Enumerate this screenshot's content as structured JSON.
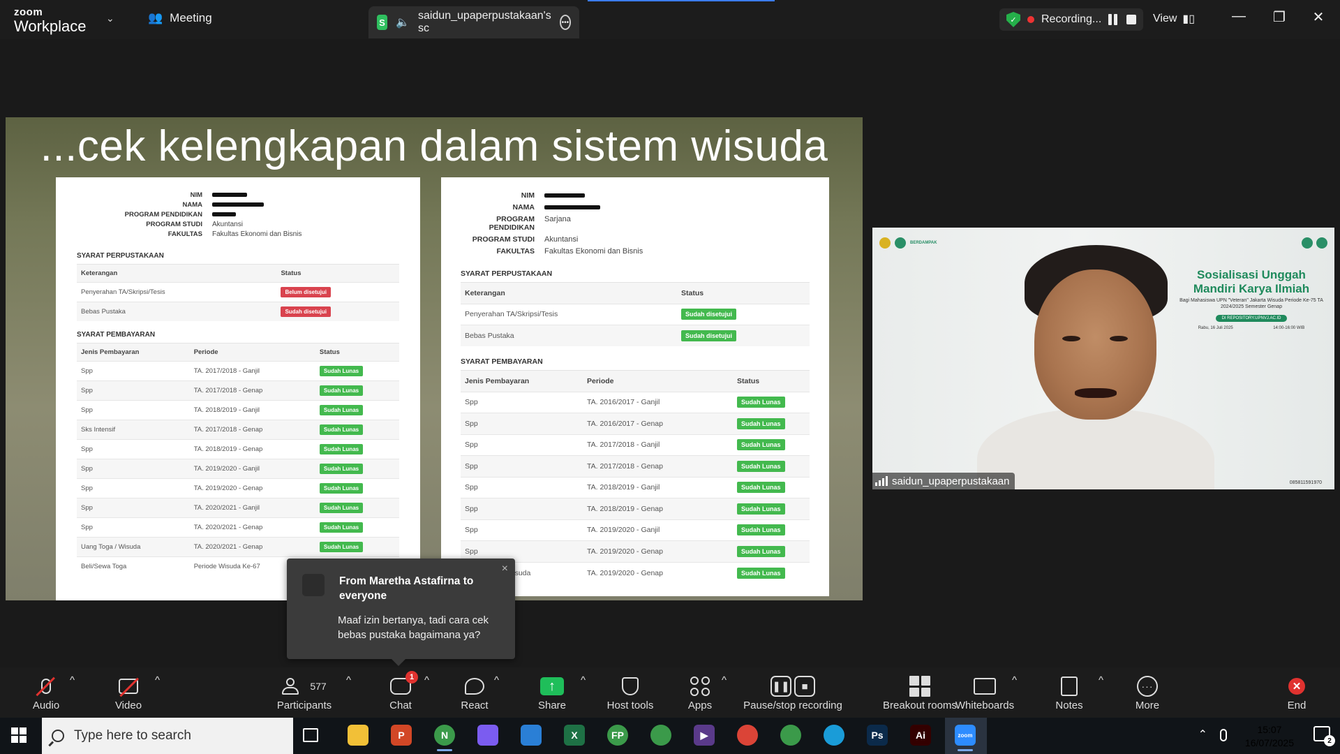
{
  "app": {
    "brand_top": "zoom",
    "brand_bottom": "Workplace"
  },
  "titlebar": {
    "meeting_label": "Meeting",
    "share_tab_badge": "S",
    "share_tab_label": "saidun_upaperpustakaan's sc",
    "recording_label": "Recording...",
    "view_label": "View",
    "window_controls": [
      "minimize-icon",
      "restore-icon",
      "close-icon"
    ]
  },
  "slide": {
    "title": "...cek kelengkapan dalam sistem wisuda",
    "left_card": {
      "fields": [
        {
          "key": "NIM",
          "value": ""
        },
        {
          "key": "NAMA",
          "value": ""
        },
        {
          "key": "PROGRAM PENDIDIKAN",
          "value": ""
        },
        {
          "key": "PROGRAM STUDI",
          "value": "Akuntansi"
        },
        {
          "key": "FAKULTAS",
          "value": "Fakultas Ekonomi dan Bisnis"
        }
      ],
      "perpus_title": "SYARAT PERPUSTAKAAN",
      "perpus_headers": [
        "Keterangan",
        "Status"
      ],
      "perpus_rows": [
        {
          "ket": "Penyerahan TA/Skripsi/Tesis",
          "status": "Belum disetujui",
          "color": "red"
        },
        {
          "ket": "Bebas Pustaka",
          "status": "Sudah disetujui",
          "color": "red"
        }
      ],
      "bayar_title": "SYARAT PEMBAYARAN",
      "bayar_headers": [
        "Jenis Pembayaran",
        "Periode",
        "Status"
      ],
      "bayar_rows": [
        [
          "Spp",
          "TA. 2017/2018 - Ganjil",
          "Sudah Lunas"
        ],
        [
          "Spp",
          "TA. 2017/2018 - Genap",
          "Sudah Lunas"
        ],
        [
          "Spp",
          "TA. 2018/2019 - Ganjil",
          "Sudah Lunas"
        ],
        [
          "Sks Intensif",
          "TA. 2017/2018 - Genap",
          "Sudah Lunas"
        ],
        [
          "Spp",
          "TA. 2018/2019 - Genap",
          "Sudah Lunas"
        ],
        [
          "Spp",
          "TA. 2019/2020 - Ganjil",
          "Sudah Lunas"
        ],
        [
          "Spp",
          "TA. 2019/2020 - Genap",
          "Sudah Lunas"
        ],
        [
          "Spp",
          "TA. 2020/2021 - Ganjil",
          "Sudah Lunas"
        ],
        [
          "Spp",
          "TA. 2020/2021 - Genap",
          "Sudah Lunas"
        ],
        [
          "Uang Toga / Wisuda",
          "TA. 2020/2021 - Genap",
          "Sudah Lunas"
        ],
        [
          "Beli/Sewa Toga",
          "Periode Wisuda Ke-67",
          ""
        ]
      ]
    },
    "right_card": {
      "fields": [
        {
          "key": "NIM",
          "value": ""
        },
        {
          "key": "NAMA",
          "value": ""
        },
        {
          "key": "PROGRAM PENDIDIKAN",
          "value": "Sarjana"
        },
        {
          "key": "PROGRAM STUDI",
          "value": "Akuntansi"
        },
        {
          "key": "FAKULTAS",
          "value": "Fakultas Ekonomi dan Bisnis"
        }
      ],
      "perpus_title": "SYARAT PERPUSTAKAAN",
      "perpus_headers": [
        "Keterangan",
        "Status"
      ],
      "perpus_rows": [
        {
          "ket": "Penyerahan TA/Skripsi/Tesis",
          "status": "Sudah disetujui",
          "color": "green"
        },
        {
          "ket": "Bebas Pustaka",
          "status": "Sudah disetujui",
          "color": "green"
        }
      ],
      "bayar_title": "SYARAT PEMBAYARAN",
      "bayar_headers": [
        "Jenis Pembayaran",
        "Periode",
        "Status"
      ],
      "bayar_rows": [
        [
          "Spp",
          "TA. 2016/2017 - Ganjil",
          "Sudah Lunas"
        ],
        [
          "Spp",
          "TA. 2016/2017 - Genap",
          "Sudah Lunas"
        ],
        [
          "Spp",
          "TA. 2017/2018 - Ganjil",
          "Sudah Lunas"
        ],
        [
          "Spp",
          "TA. 2017/2018 - Genap",
          "Sudah Lunas"
        ],
        [
          "Spp",
          "TA. 2018/2019 - Ganjil",
          "Sudah Lunas"
        ],
        [
          "Spp",
          "TA. 2018/2019 - Genap",
          "Sudah Lunas"
        ],
        [
          "Spp",
          "TA. 2019/2020 - Ganjil",
          "Sudah Lunas"
        ],
        [
          "Spp",
          "TA. 2019/2020 - Genap",
          "Sudah Lunas"
        ],
        [
          "Uang Toga / Wisuda",
          "TA. 2019/2020 - Genap",
          "Sudah Lunas"
        ]
      ]
    }
  },
  "chat_popup": {
    "from": "From Maretha Astafirna to everyone",
    "message": "Maaf izin bertanya, tadi cara cek bebas pustaka bagaimana ya?",
    "close": "×"
  },
  "video": {
    "participant_name": "saidun_upaperpustakaan",
    "banner_line1": "Sosialisasi Unggah",
    "banner_line2": "Mandiri Karya Ilmiah",
    "banner_sub": "Bagi Mahasiswa UPN \"Veteran\" Jakarta Wisuda Periode Ke-75 TA 2024/2025 Semester Genap",
    "banner_pill": "DI REPOSITORY.UPNVJ.AC.ID",
    "banner_date": "Rabu, 16 Juli 2025",
    "banner_time": "14:00-16:00 WIB",
    "banner_phone": "085811591970",
    "logo_text": "BERDAMPAK"
  },
  "toolbar": {
    "audio": "Audio",
    "video": "Video",
    "participants": "Participants",
    "participants_count": "577",
    "chat": "Chat",
    "chat_badge": "1",
    "react": "React",
    "share": "Share",
    "host_tools": "Host tools",
    "apps": "Apps",
    "pause_stop": "Pause/stop recording",
    "breakout": "Breakout rooms",
    "whiteboards": "Whiteboards",
    "notes": "Notes",
    "more": "More",
    "end": "End"
  },
  "taskbar": {
    "search_placeholder": "Type here to search",
    "time": "15:07",
    "date": "16/07/2025",
    "notification_count": "2",
    "apps": [
      {
        "name": "task-view-icon",
        "label": "",
        "color": "#101418"
      },
      {
        "name": "file-explorer-icon",
        "label": "",
        "color": "#f2c037"
      },
      {
        "name": "powerpoint-icon",
        "label": "P",
        "color": "#d24726"
      },
      {
        "name": "chrome-profile-icon",
        "label": "N",
        "color": "#3b9a4a"
      },
      {
        "name": "copilot-icon",
        "label": "",
        "color": "#7b5cf0"
      },
      {
        "name": "microsoft-store-icon",
        "label": "",
        "color": "#2a7fd6"
      },
      {
        "name": "excel-icon",
        "label": "X",
        "color": "#1e7145"
      },
      {
        "name": "chrome-profile-fp-icon",
        "label": "FP",
        "color": "#3b9a4a"
      },
      {
        "name": "chrome-profile-2-icon",
        "label": "",
        "color": "#3b9a4a"
      },
      {
        "name": "media-player-icon",
        "label": "▶",
        "color": "#5a3a8a"
      },
      {
        "name": "chrome-icon",
        "label": "",
        "color": "#db4437"
      },
      {
        "name": "chrome-profile-3-icon",
        "label": "",
        "color": "#3b9a4a"
      },
      {
        "name": "edge-icon",
        "label": "",
        "color": "#1a9cd8"
      },
      {
        "name": "photoshop-icon",
        "label": "Ps",
        "color": "#0b2a4a"
      },
      {
        "name": "illustrator-icon",
        "label": "Ai",
        "color": "#330000"
      },
      {
        "name": "zoom-taskbar-icon",
        "label": "zoom",
        "color": "#2d8cff"
      }
    ]
  }
}
